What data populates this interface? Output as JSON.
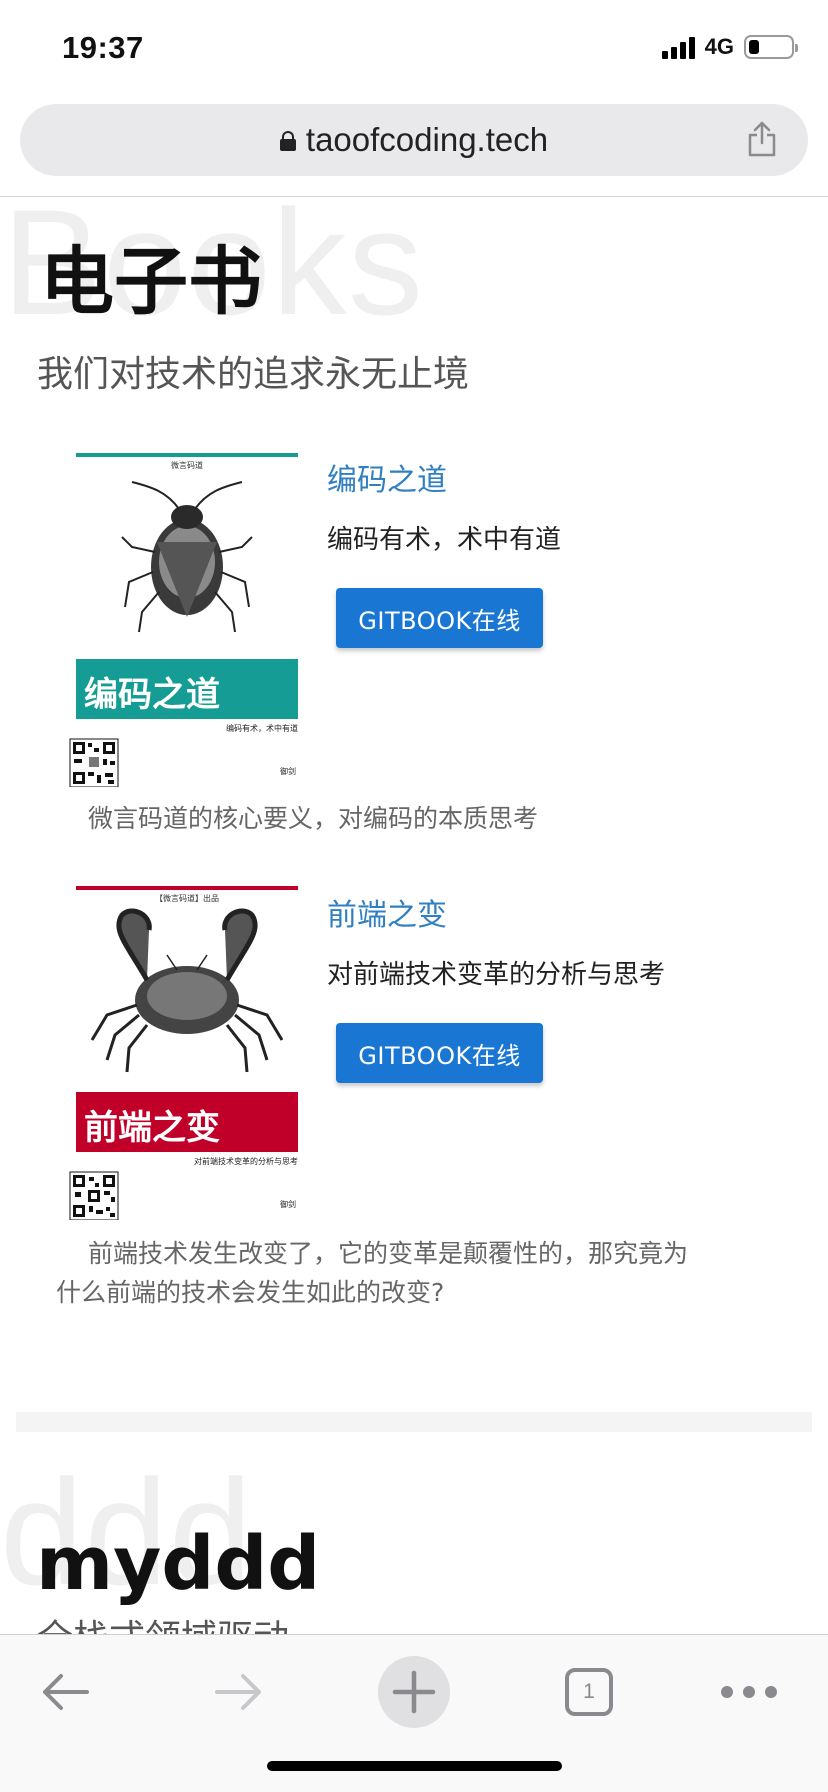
{
  "status_bar": {
    "time": "19:37",
    "network": "4G",
    "battery_level": 0.25
  },
  "browser": {
    "url": "taoofcoding.tech",
    "tab_count": "1"
  },
  "icons": {
    "lock": "lock-icon",
    "share": "share-icon",
    "back": "back-arrow-icon",
    "forward": "forward-arrow-icon",
    "new_tab": "plus-icon",
    "tabs": "tabs-icon",
    "more": "more-icon"
  },
  "section_books": {
    "bg_word": "Books",
    "title": "电子书",
    "subtitle": "我们对技术的追求永无止境",
    "books": [
      {
        "cover": {
          "header": "微言码道",
          "title": "编码之道",
          "subtitle": "编码有术，术中有道",
          "author": "御剑",
          "accent_color": "#159d95",
          "image": "insect-illustration"
        },
        "name": "编码之道",
        "tagline": "编码有术，术中有道",
        "button_label": "GITBOOK在线",
        "description": "微言码道的核心要义，对编码的本质思考"
      },
      {
        "cover": {
          "header": "【微言码道】出品",
          "title": "前端之变",
          "subtitle": "对前端技术变革的分析与思考",
          "author": "御剑",
          "accent_color": "#c1002a",
          "image": "crab-illustration"
        },
        "name": "前端之变",
        "tagline": "对前端技术变革的分析与思考",
        "button_label": "GITBOOK在线",
        "description_line1": "前端技术发生改变了，它的变革是颠覆性的，那究竟为",
        "description_line2": "什么前端的技术会发生如此的改变?"
      }
    ]
  },
  "section_myddd": {
    "bg_word": "ddd",
    "title": "myddd",
    "subtitle": "全栈式领域驱动"
  },
  "colors": {
    "link": "#2f7fc1",
    "button": "#1976d2"
  }
}
